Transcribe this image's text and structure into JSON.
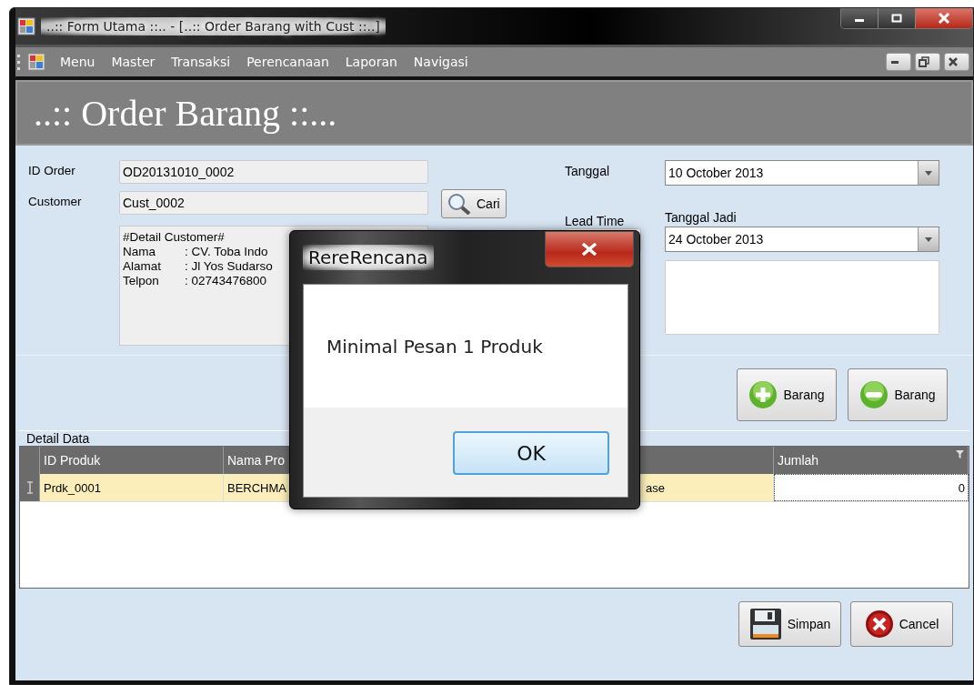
{
  "window": {
    "title": "..:: Form Utama ::.. - [..:: Order Barang with Cust ::..]"
  },
  "menu": [
    "Menu",
    "Master",
    "Transaksi",
    "Perencanaan",
    "Laporan",
    "Navigasi"
  ],
  "header": "..:: Order Barang ::...",
  "form": {
    "id_order": {
      "label": "ID Order",
      "value": "OD20131010_0002"
    },
    "customer": {
      "label": "Customer",
      "value": "Cust_0002",
      "button": "Cari"
    },
    "detail_lines": [
      "#Detail Customer#",
      {
        "key": "Nama",
        "value": ": CV. Toba Indo"
      },
      {
        "key": "Alamat",
        "value": ": Jl Yos Sudarso"
      },
      {
        "key": "Telpon",
        "value": ": 02743476800"
      }
    ],
    "tanggal": {
      "label": "Tanggal",
      "value": "10 October 2013"
    },
    "lead_time": {
      "label": "Lead Time"
    },
    "tanggal_jadi": {
      "label": "Tanggal Jadi",
      "value": "24 October 2013"
    }
  },
  "item_buttons": [
    {
      "kind": "add",
      "label": "Barang"
    },
    {
      "kind": "remove",
      "label": "Barang"
    }
  ],
  "detail": {
    "title": "Detail Data",
    "columns": [
      {
        "label": "ID Produk"
      },
      {
        "label": "Nama Pro"
      },
      {},
      {},
      {
        "label": "Jumlah"
      }
    ],
    "rows": [
      {
        "cells": [
          {
            "text": "Prdk_0001"
          },
          {
            "text": "BERCHMA"
          },
          {},
          {
            "text": "ase"
          },
          {
            "text": "0",
            "editing": true
          }
        ]
      }
    ]
  },
  "footer_buttons": [
    {
      "kind": "save",
      "label": "Simpan"
    },
    {
      "kind": "cancel",
      "label": "Cancel"
    }
  ],
  "dialog": {
    "title": "RereRencana",
    "message": "Minimal Pesan 1 Produk",
    "button": "OK"
  }
}
